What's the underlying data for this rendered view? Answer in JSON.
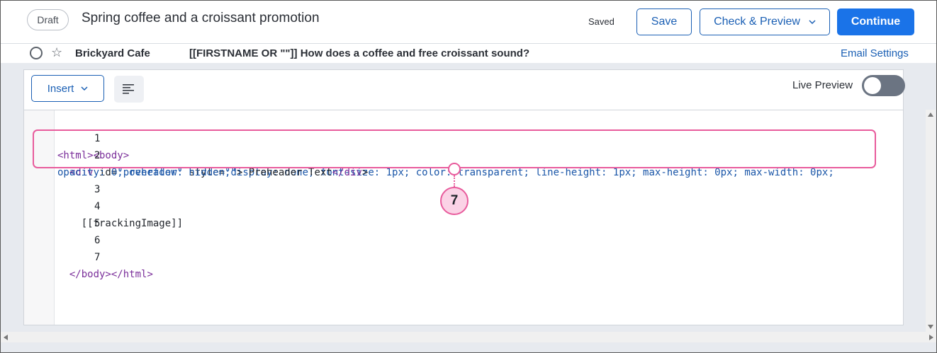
{
  "header": {
    "status_badge": "Draft",
    "title": "Spring coffee and a croissant promotion",
    "save_status": "Saved",
    "save_label": "Save",
    "check_preview_label": "Check & Preview",
    "continue_label": "Continue"
  },
  "subheader": {
    "sender": "Brickyard Cafe",
    "subject": "[[FIRSTNAME OR \"\"]] How does a coffee and free croissant sound?",
    "email_settings_label": "Email Settings"
  },
  "toolbar": {
    "insert_label": "Insert",
    "live_preview_label": "Live Preview",
    "live_preview_on": false
  },
  "code": {
    "line_numbers": [
      "1",
      "2",
      "",
      "3",
      "4",
      "5",
      "6",
      "7"
    ],
    "lines": {
      "l1_open_html": "<html>",
      "l1_open_body": "<body>",
      "l2_div_open": "<div",
      "l2_id_attr": " id=",
      "l2_id_val": "\"preheader\"",
      "l2_style_attr": " style=",
      "l2_style_val_a": "\"display: none; font-size: 1px; color: transparent; line-height: 1px; max-height: 0px; max-width: 0px;",
      "l2_style_val_b": "opacity: 0; overflow: hidden;\"",
      "l2_text": "> Preheader Text",
      "l2_div_close": "</div",
      "l2_gt": ">",
      "l4_text": "[[trackingImage]]",
      "l7_close_body": "</body>",
      "l7_close_html": "</html>"
    }
  },
  "annotation": {
    "step_number": "7",
    "color": "#e85b9c"
  },
  "colors": {
    "primary": "#1a73e8",
    "outline_blue": "#1a5fb4",
    "tag_purple": "#7a2e9a",
    "string_blue": "#1a56a8"
  }
}
